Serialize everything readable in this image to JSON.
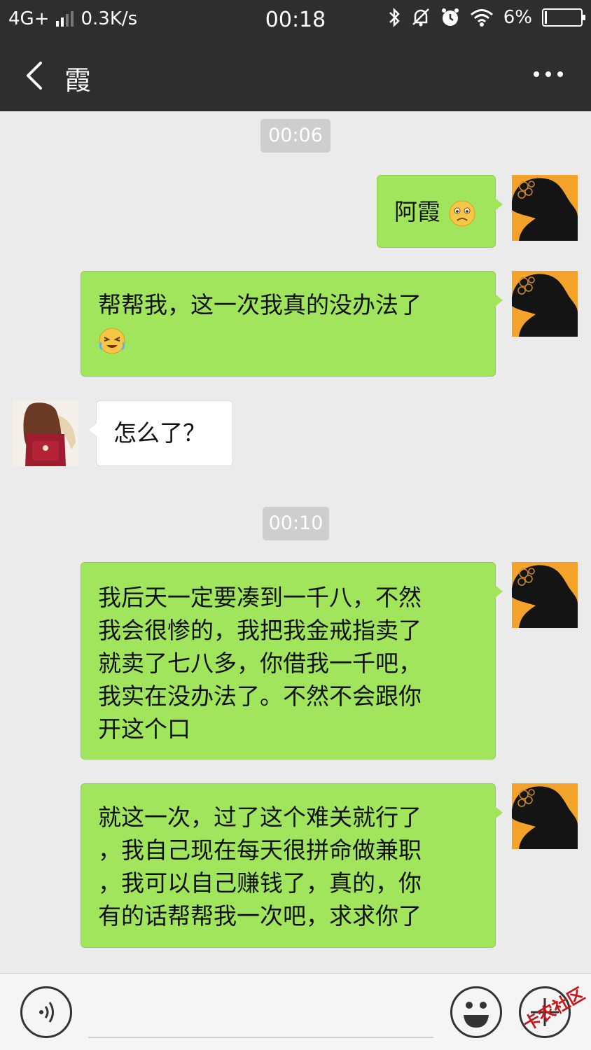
{
  "status_bar": {
    "network": "4G+",
    "speed": "0.3K/s",
    "time": "00:18",
    "battery": "6%",
    "battery_level": 0.06
  },
  "header": {
    "title": "霞"
  },
  "messages": [
    {
      "type": "timestamp",
      "text": "00:06"
    },
    {
      "type": "sent",
      "text": "阿霞",
      "emoji": "frown-emoji"
    },
    {
      "type": "sent",
      "text": "帮帮我，这一次我真的没办法了",
      "emoji": "crying-emoji"
    },
    {
      "type": "received",
      "text": "怎么了？"
    },
    {
      "type": "timestamp",
      "text": "00:10"
    },
    {
      "type": "sent",
      "lines": [
        "我后天一定要凑到一千八，不然",
        "我会很惨的，我把我金戒指卖了",
        "就卖了七八多，你借我一千吧，",
        "我实在没办法了。不然不会跟你",
        "开这个口"
      ]
    },
    {
      "type": "sent",
      "lines": [
        "就这一次，过了这个难关就行了",
        "，我自己现在每天很拼命做兼职",
        "，我可以自己赚钱了，真的，你",
        "有的话帮帮我一次吧，求求你了"
      ]
    }
  ],
  "watermark": "卡农社区",
  "colors": {
    "header_bg": "#2e2e2e",
    "chat_bg": "#ebebeb",
    "sent_bubble": "#a1e55c",
    "received_bubble": "#ffffff",
    "timestamp_bg": "#cecece"
  }
}
